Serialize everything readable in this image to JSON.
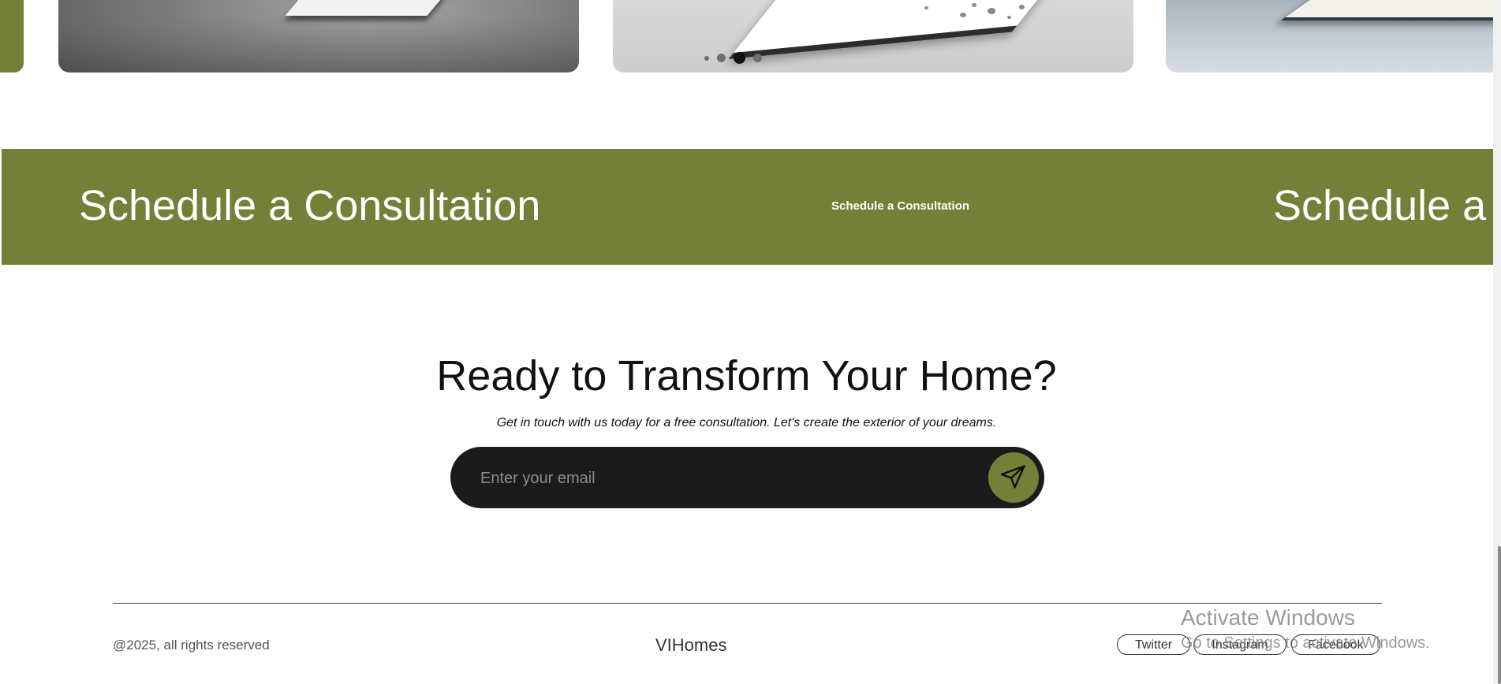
{
  "carousel": {
    "dot_count": 4,
    "active_dot": 2
  },
  "banner": {
    "large_text": "Schedule a Consultation",
    "large_text_repeat": "Schedule a C",
    "small_text": "Schedule a Consultation"
  },
  "cta": {
    "title": "Ready to Transform Your Home?",
    "subtitle": "Get in touch with us today for a free consultation. Let's create the exterior of your dreams.",
    "email_placeholder": "Enter your email",
    "email_value": "",
    "send_icon": "send-icon"
  },
  "footer": {
    "copyright": "@2025, all rights reserved",
    "brand": "VIHomes",
    "social": [
      "Twitter",
      "Instagram",
      "Facebook"
    ]
  },
  "watermark": {
    "title": "Activate Windows",
    "subtitle": "Go to Settings to activate Windows."
  },
  "colors": {
    "accent_green": "#747f37",
    "dark_input": "#1b1b1b"
  }
}
